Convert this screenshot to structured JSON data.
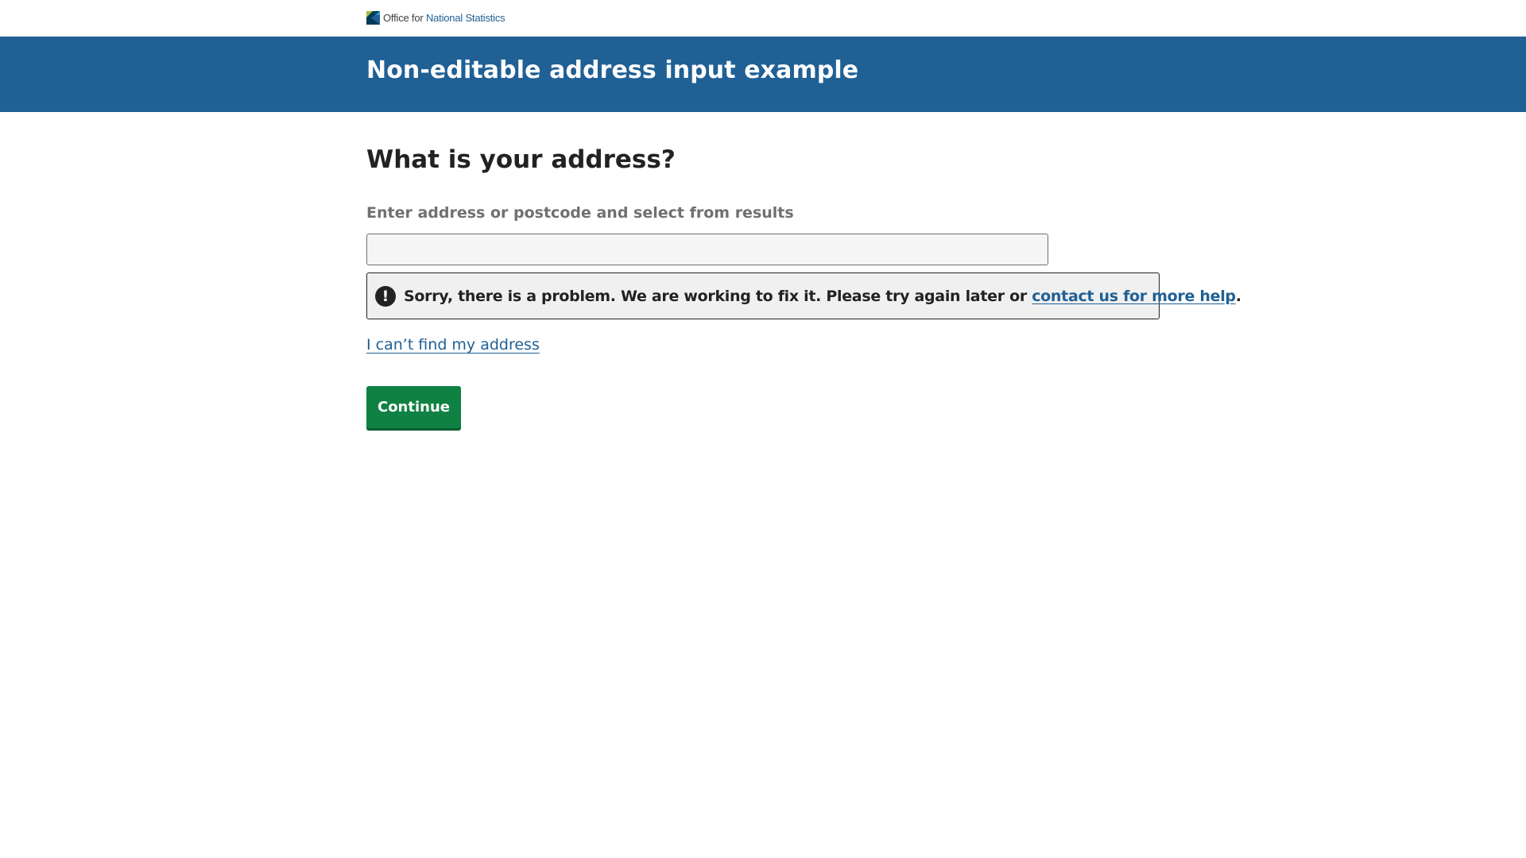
{
  "header": {
    "logo_text_light": "Office for",
    "logo_text_strong": "National Statistics"
  },
  "banner": {
    "title": "Non-editable address input example"
  },
  "form": {
    "question": "What is your address?",
    "field_label": "Enter address or postcode and select from results",
    "input_value": "",
    "input_placeholder": "",
    "error_message": "Sorry, there is a problem. We are working to fix it. Please try again later or ",
    "error_link": "contact us for more help",
    "error_suffix": ".",
    "error_icon_glyph": "!",
    "cant_find_link": "I can’t find my address",
    "continue_label": "Continue"
  },
  "colors": {
    "brand_blue": "#206095",
    "button_green": "#0f8243",
    "text_dark": "#222222",
    "label_grey": "#707071"
  },
  "icons": {
    "logo": "ons-logo-icon",
    "error": "exclamation-icon"
  }
}
